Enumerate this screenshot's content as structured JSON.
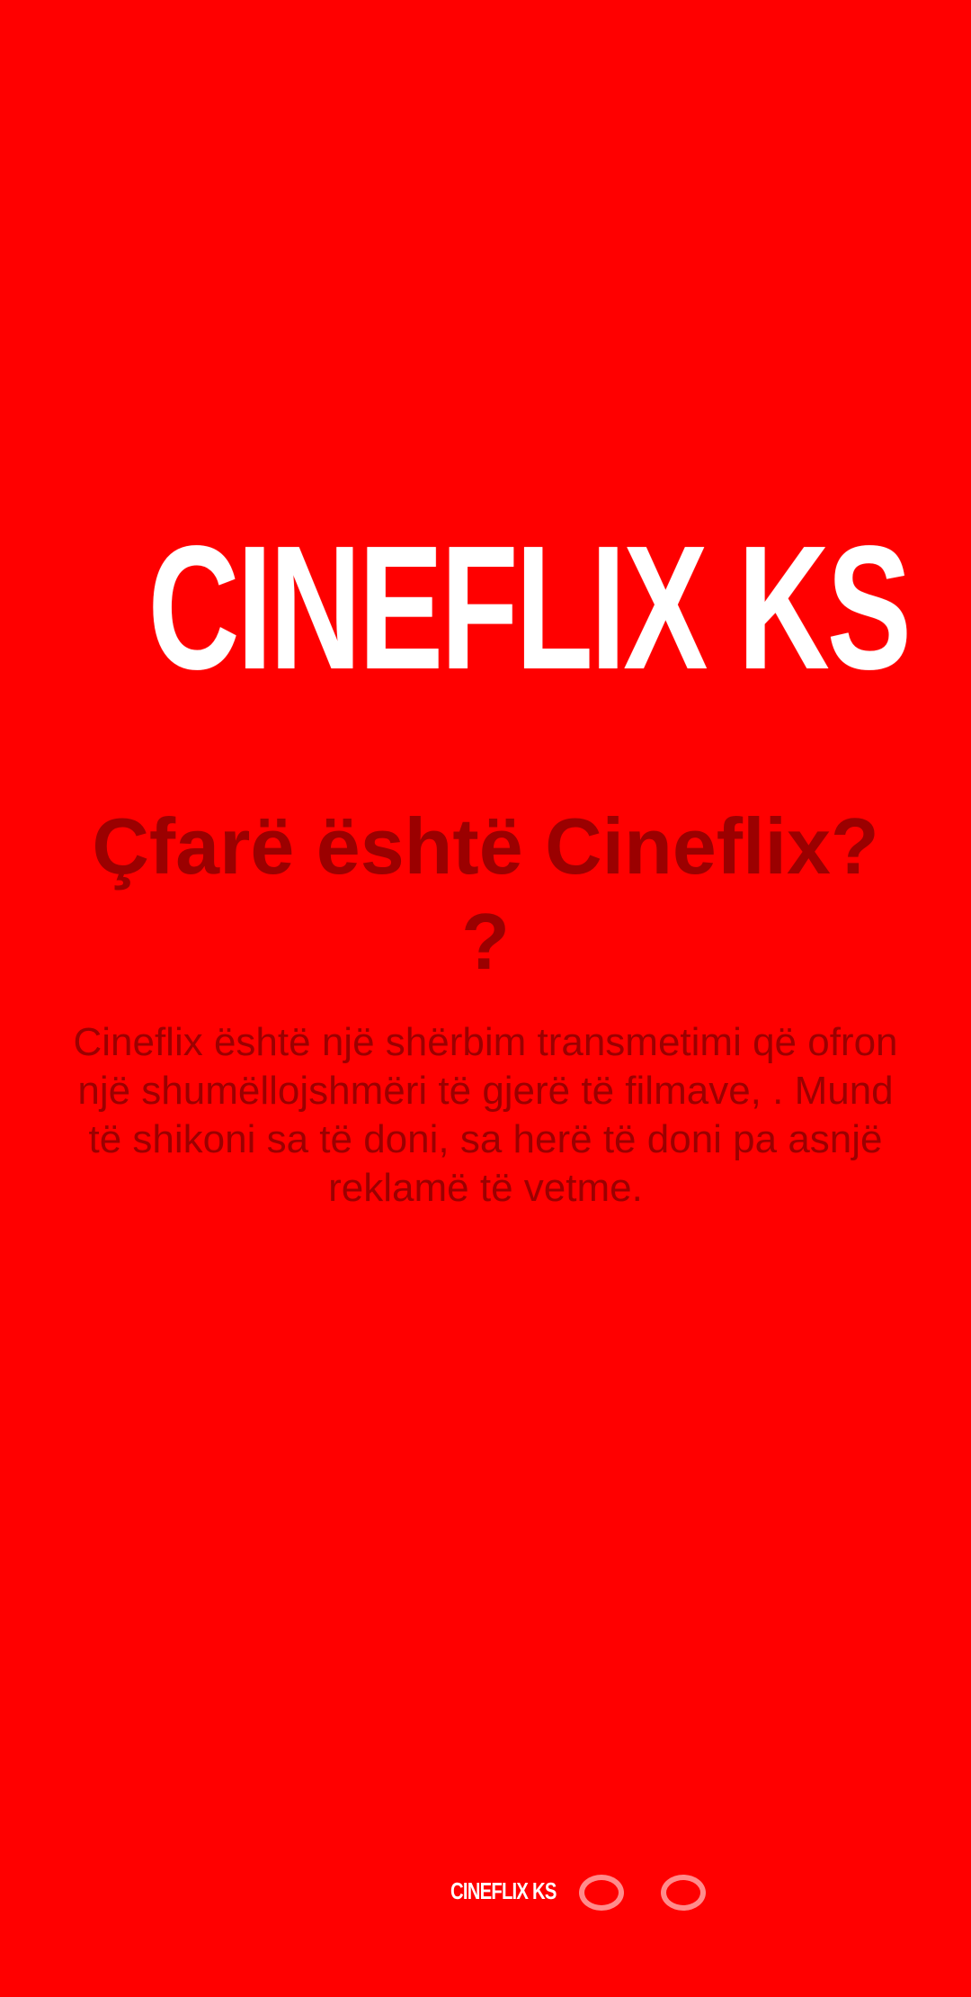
{
  "app": {
    "logo_text": "CINEFLIX KS"
  },
  "onboarding": {
    "headline": "Çfarë është Cineflix? ?",
    "description": "Cineflix është një shërbim transmetimi që ofron një shumëllojshmëri të gjerë të filmave, . Mund të shikoni sa të doni, sa herë të doni pa asnjë reklamë të vetme."
  },
  "pager": {
    "label": "CINEFLIX KS",
    "page_count": 3,
    "current_page": 1
  },
  "colors": {
    "background": "#ff0000",
    "headline_text": "#9b0000",
    "logo_text": "#ffffff",
    "inactive_dot": "#ff8c8c"
  }
}
